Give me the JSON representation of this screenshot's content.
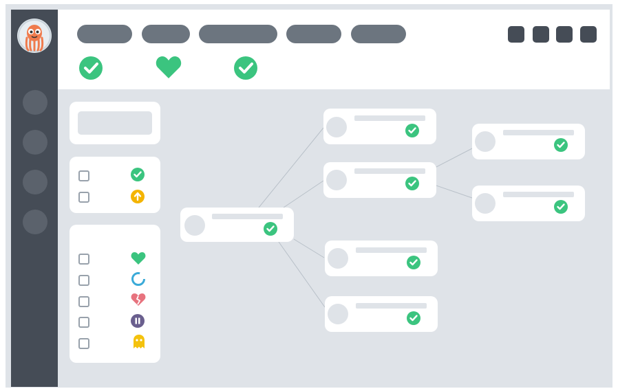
{
  "app": {
    "logo_icon": "argo-octopus-mascot-icon"
  },
  "sidebar": {
    "nav_items": [
      "nav-item-1",
      "nav-item-2",
      "nav-item-3",
      "nav-item-4"
    ]
  },
  "toolbar": {
    "tabs": [
      "tab-1",
      "tab-2",
      "tab-3",
      "tab-4",
      "tab-5"
    ],
    "actions": [
      "action-1",
      "action-2",
      "action-3",
      "action-4"
    ],
    "status_icons": [
      "sync-status-check-icon",
      "health-status-heart-icon",
      "operation-status-check-icon"
    ]
  },
  "filters": {
    "sync_status": [
      {
        "icon": "check-circle-icon",
        "color": "#3bc47f"
      },
      {
        "icon": "out-of-sync-arrow-icon",
        "color": "#f4b400"
      }
    ],
    "health_status": [
      {
        "icon": "heart-healthy-icon",
        "color": "#3bc47f"
      },
      {
        "icon": "progressing-ring-icon",
        "color": "#3aaad8"
      },
      {
        "icon": "broken-heart-degraded-icon",
        "color": "#e7737e"
      },
      {
        "icon": "paused-icon",
        "color": "#6a5f8e"
      },
      {
        "icon": "missing-ghost-icon",
        "color": "#f4c20d"
      }
    ]
  },
  "colors": {
    "sidebar": "#454c56",
    "success": "#3bc47f",
    "background": "#dfe3e8"
  }
}
